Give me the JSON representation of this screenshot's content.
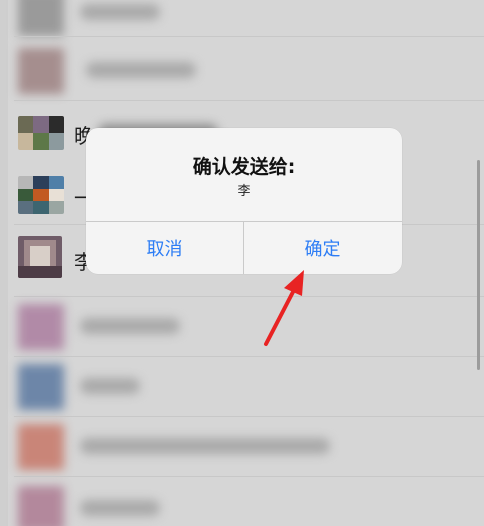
{
  "list": {
    "rows": [
      {
        "name": "晚"
      },
      {
        "name": "一"
      },
      {
        "name": "李"
      }
    ]
  },
  "dialog": {
    "title": "确认发送给:",
    "recipient": "李",
    "cancel_label": "取消",
    "confirm_label": "确定"
  },
  "colors": {
    "accent": "#2d7df5",
    "annotation_arrow": "#e82323"
  }
}
